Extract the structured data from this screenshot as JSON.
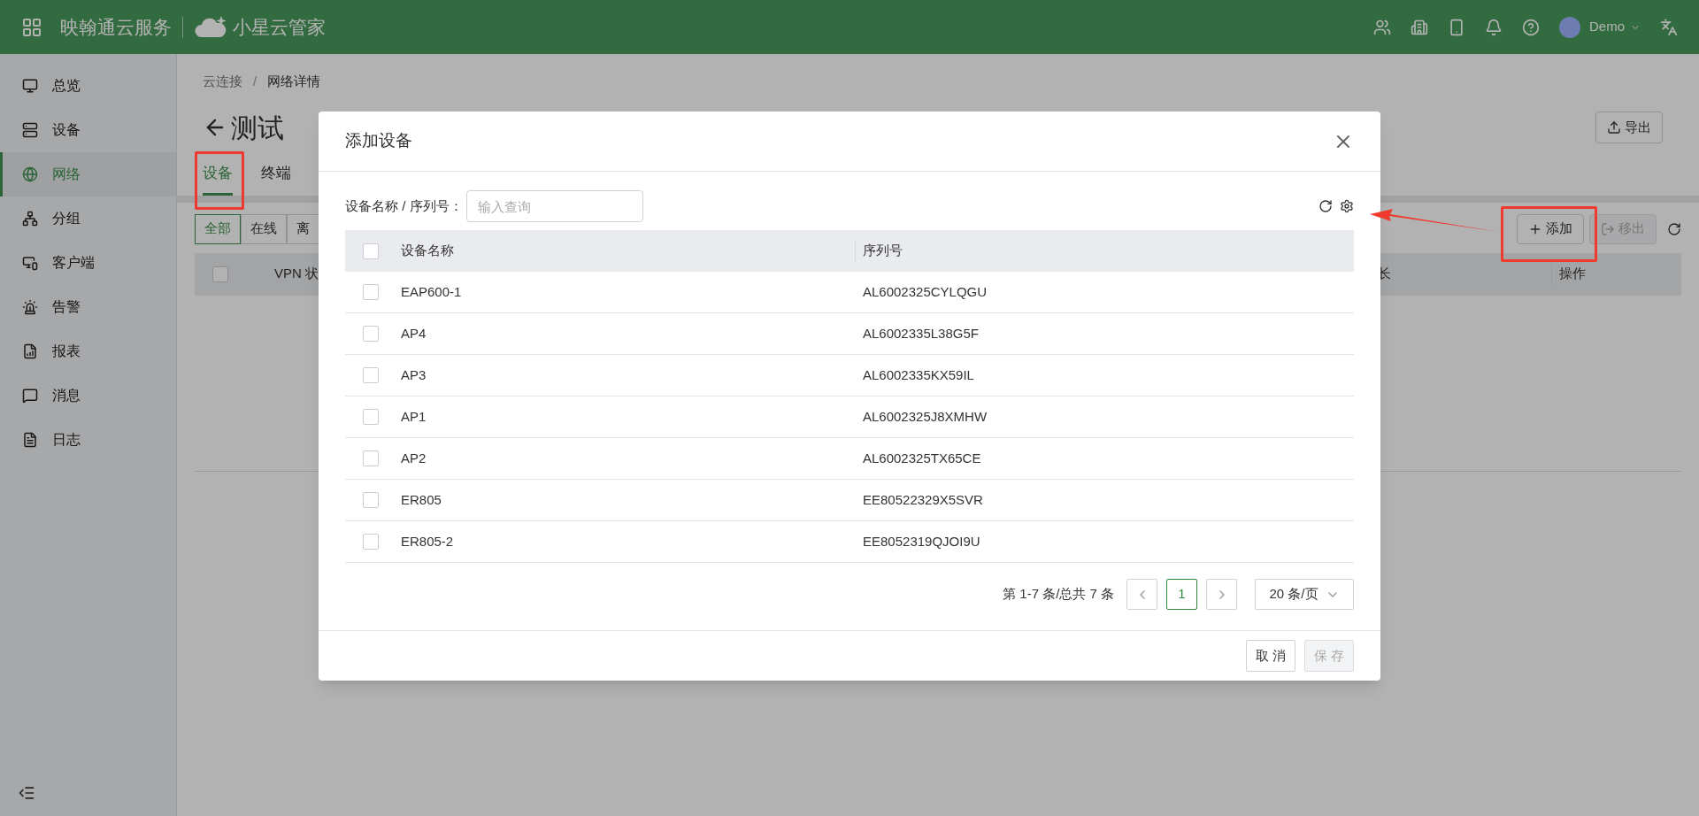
{
  "header": {
    "brand": "映翰通云服务",
    "product": "小星云管家",
    "user": "Demo"
  },
  "sidebar": {
    "items": [
      {
        "label": "总览",
        "selected": false
      },
      {
        "label": "设备",
        "selected": false
      },
      {
        "label": "网络",
        "selected": true
      },
      {
        "label": "分组",
        "selected": false
      },
      {
        "label": "客户端",
        "selected": false
      },
      {
        "label": "告警",
        "selected": false
      },
      {
        "label": "报表",
        "selected": false
      },
      {
        "label": "消息",
        "selected": false
      },
      {
        "label": "日志",
        "selected": false
      }
    ]
  },
  "page": {
    "breadcrumb": [
      "云连接",
      "/",
      "网络详情"
    ],
    "select_all_checked": false,
    "title": "测试",
    "export_button": "导出",
    "tabs": [
      {
        "label": "设备",
        "selected": true
      },
      {
        "label": "终端",
        "selected": false
      }
    ],
    "filters": [
      {
        "label": "全部",
        "selected": true
      },
      {
        "label": "在线",
        "selected": false
      },
      {
        "label": "离",
        "selected": false
      }
    ],
    "add_button": "添加",
    "remove_button": {
      "label": "移出",
      "disabled": true
    },
    "table_columns": [
      "VPN 状",
      "长",
      "操作"
    ]
  },
  "modal": {
    "title": "添加设备",
    "search_label": "设备名称 / 序列号：",
    "search_placeholder": "输入查询",
    "columns": [
      "设备名称",
      "序列号"
    ],
    "select_all_checked": false,
    "rows": [
      {
        "name": "EAP600-1",
        "serial": "AL6002325CYLQGU",
        "checked": false
      },
      {
        "name": "AP4",
        "serial": "AL6002335L38G5F",
        "checked": false
      },
      {
        "name": "AP3",
        "serial": "AL6002335KX59IL",
        "checked": false
      },
      {
        "name": "AP1",
        "serial": "AL6002325J8XMHW",
        "checked": false
      },
      {
        "name": "AP2",
        "serial": "AL6002325TX65CE",
        "checked": false
      },
      {
        "name": "ER805",
        "serial": "EE80522329X5SVR",
        "checked": false
      },
      {
        "name": "ER805-2",
        "serial": "EE8052319QJOI9U",
        "checked": false
      }
    ],
    "pagination": {
      "summary": "第 1-7 条/总共 7 条",
      "pages": [
        {
          "label": "1",
          "selected": true
        }
      ],
      "page_size": "20 条/页"
    },
    "cancel_button": "取 消",
    "save_button": {
      "label": "保 存",
      "disabled": true
    }
  }
}
